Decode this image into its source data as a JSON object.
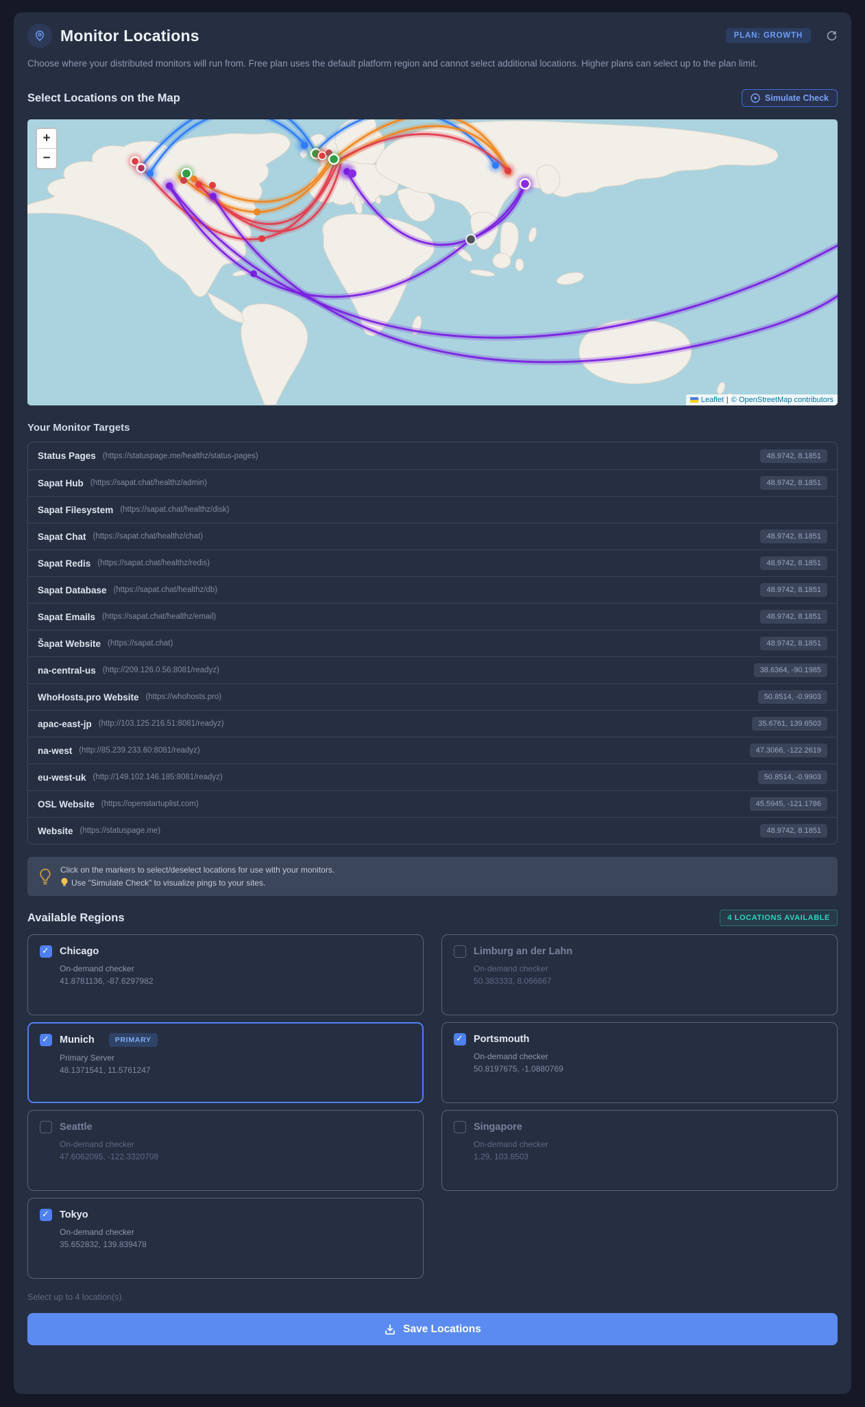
{
  "header": {
    "title": "Monitor Locations",
    "plan_badge": "PLAN: GROWTH",
    "description": "Choose where your distributed monitors will run from. Free plan uses the default platform region and cannot select additional locations. Higher plans can select up to the plan limit."
  },
  "map_section": {
    "heading": "Select Locations on the Map",
    "simulate_button": "Simulate Check",
    "zoom_in": "+",
    "zoom_out": "−",
    "attribution_leaflet": "Leaflet",
    "attribution_separator": "|",
    "attribution_osm": "© OpenStreetMap contributors"
  },
  "targets": {
    "heading": "Your Monitor Targets",
    "rows": [
      {
        "name": "Status Pages",
        "url": "(https://statuspage.me/healthz/status-pages)",
        "coords": "48.9742, 8.1851"
      },
      {
        "name": "Sapat Hub",
        "url": "(https://sapat.chat/healthz/admin)",
        "coords": "48.9742, 8.1851"
      },
      {
        "name": "Sapat Filesystem",
        "url": "(https://sapat.chat/healthz/disk)",
        "coords": ""
      },
      {
        "name": "Sapat Chat",
        "url": "(https://sapat.chat/healthz/chat)",
        "coords": "48.9742, 8.1851"
      },
      {
        "name": "Sapat Redis",
        "url": "(https://sapat.chat/healthz/redis)",
        "coords": "48.9742, 8.1851"
      },
      {
        "name": "Sapat Database",
        "url": "(https://sapat.chat/healthz/db)",
        "coords": "48.9742, 8.1851"
      },
      {
        "name": "Sapat Emails",
        "url": "(https://sapat.chat/healthz/email)",
        "coords": "48.9742, 8.1851"
      },
      {
        "name": "Šapat Website",
        "url": "(https://sapat.chat)",
        "coords": "48.9742, 8.1851"
      },
      {
        "name": "na-central-us",
        "url": "(http://209.126.0.56:8081/readyz)",
        "coords": "38.6364, -90.1985"
      },
      {
        "name": "WhoHosts.pro Website",
        "url": "(https://whohosts.pro)",
        "coords": "50.8514, -0.9903"
      },
      {
        "name": "apac-east-jp",
        "url": "(http://103.125.216.51:8081/readyz)",
        "coords": "35.6761, 139.6503"
      },
      {
        "name": "na-west",
        "url": "(http://85.239.233.60:8081/readyz)",
        "coords": "47.3066, -122.2619"
      },
      {
        "name": "eu-west-uk",
        "url": "(http://149.102.146.185:8081/readyz)",
        "coords": "50.8514, -0.9903"
      },
      {
        "name": "OSL Website",
        "url": "(https://openstartuplist.com)",
        "coords": "45.5945, -121.1786"
      },
      {
        "name": "Website",
        "url": "(https://statuspage.me)",
        "coords": "48.9742, 8.1851"
      }
    ]
  },
  "tip": {
    "line1": "Click on the markers to select/deselect locations for use with your monitors.",
    "line2": "Use \"Simulate Check\" to visualize pings to your sites."
  },
  "regions": {
    "heading": "Available Regions",
    "badge": "4 LOCATIONS AVAILABLE",
    "cards": [
      {
        "name": "Chicago",
        "desc": "On-demand checker",
        "coords": "41.8781136, -87.6297982",
        "checked": true
      },
      {
        "name": "Limburg an der Lahn",
        "desc": "On-demand checker",
        "coords": "50.383333, 8.066667",
        "checked": false
      },
      {
        "name": "Munich",
        "badge": "PRIMARY",
        "desc": "Primary Server",
        "coords": "48.1371541, 11.5761247",
        "checked": true
      },
      {
        "name": "Portsmouth",
        "desc": "On-demand checker",
        "coords": "50.8197675, -1.0880769",
        "checked": true
      },
      {
        "name": "Seattle",
        "desc": "On-demand checker",
        "coords": "47.6062095, -122.3320708",
        "checked": false
      },
      {
        "name": "Singapore",
        "desc": "On-demand checker",
        "coords": "1.29, 103.8503",
        "checked": false
      },
      {
        "name": "Tokyo",
        "desc": "On-demand checker",
        "coords": "35.652832, 139.839478",
        "checked": true
      }
    ],
    "footnote": "Select up to 4 location(s)."
  },
  "save_button": "Save Locations",
  "colors": {
    "accent_blue": "#5b8bf0",
    "plan_badge_text": "#6f9df6",
    "teal_badge": "#2dd4bf",
    "arc_blue": "#2e7bf6",
    "arc_orange": "#f0861f",
    "arc_red": "#e03e4e",
    "arc_purple": "#7a1fe0",
    "marker_green": "#2f9e44",
    "map_ocean": "#aad3df",
    "map_land": "#f2efe9",
    "bulb_yellow": "#d9a441"
  }
}
